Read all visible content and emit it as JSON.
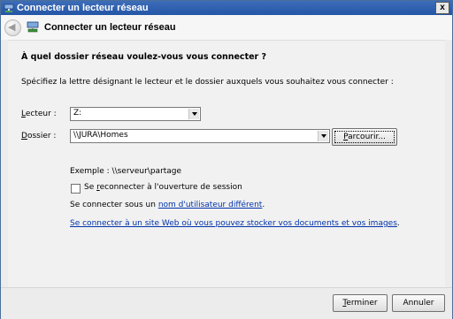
{
  "window": {
    "title": "Connecter un lecteur réseau",
    "close_label": "x"
  },
  "header": {
    "back_glyph": "◀",
    "title": "Connecter un lecteur réseau"
  },
  "main": {
    "question": "À quel dossier réseau voulez-vous vous connecter ?",
    "description": "Spécifiez la lettre désignant le lecteur et le dossier auxquels vous souhaitez vous connecter :",
    "drive": {
      "label_prefix": "",
      "label_accel": "L",
      "label_rest": "ecteur :",
      "value": "Z:"
    },
    "folder": {
      "label_accel": "D",
      "label_rest": "ossier :",
      "value": "\\\\JURA\\Homes",
      "browse_accel": "P",
      "browse_rest": "arcourir..."
    },
    "example": "Exemple : \\\\serveur\\partage",
    "reconnect": {
      "label_pre": "Se ",
      "label_accel": "r",
      "label_rest": "econnecter à l'ouverture de session",
      "checked": false
    },
    "other_user": {
      "prefix": "Se connecter sous un ",
      "link": "nom d'utilisateur différent",
      "suffix": "."
    },
    "website_link": "Se connecter à un site Web où vous pouvez stocker vos documents et vos images",
    "website_suffix": "."
  },
  "footer": {
    "finish_accel": "T",
    "finish_rest": "erminer",
    "cancel_label": "Annuler"
  },
  "colors": {
    "titlebar": "#2456a6",
    "link": "#0033aa",
    "background": "#f1f1f1"
  }
}
